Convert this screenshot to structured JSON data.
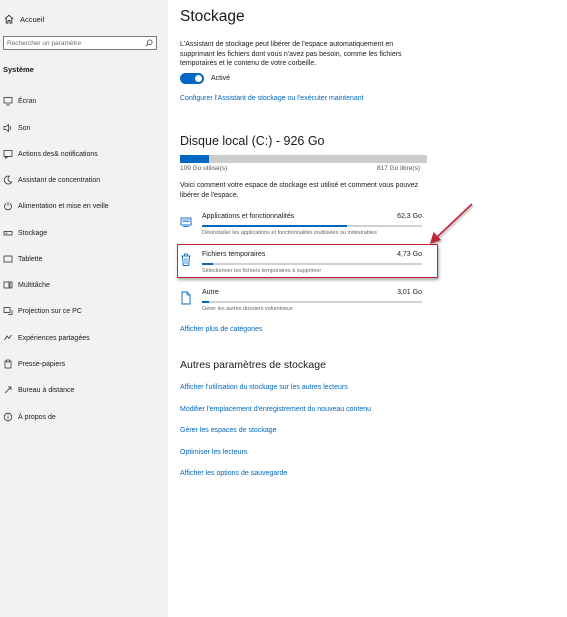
{
  "sidebar": {
    "home_label": "Accueil",
    "search_placeholder": "Rechercher un paramètre",
    "section_title": "Système",
    "items": [
      {
        "label": "Écran",
        "icon": "monitor-icon"
      },
      {
        "label": "Son",
        "icon": "speaker-icon"
      },
      {
        "label": "Actions des& notifications",
        "icon": "notification-icon"
      },
      {
        "label": "Assistant de concentration",
        "icon": "moon-icon"
      },
      {
        "label": "Alimentation et mise en veille",
        "icon": "power-icon"
      },
      {
        "label": "Stockage",
        "icon": "storage-icon"
      },
      {
        "label": "Tablette",
        "icon": "tablet-icon"
      },
      {
        "label": "Multitâche",
        "icon": "multitask-icon"
      },
      {
        "label": "Projection sur ce PC",
        "icon": "projection-icon"
      },
      {
        "label": "Expériences partagées",
        "icon": "shared-icon"
      },
      {
        "label": "Presse-papiers",
        "icon": "clipboard-icon"
      },
      {
        "label": "Bureau à distance",
        "icon": "remote-desktop-icon"
      },
      {
        "label": "À propos de",
        "icon": "info-icon"
      }
    ]
  },
  "main": {
    "title": "Stockage",
    "description": "L'Assistant de stockage peut libérer de l'espace automatiquement en supprimant les fichiers dont vous n'avez pas besoin, comme les fichiers temporaires et le contenu de votre corbeille.",
    "toggle_state": "Activé",
    "configure_link": "Configurer l'Assistant de stockage ou l'exécuter maintenant",
    "disk": {
      "title": "Disque local (C:) - 926 Go",
      "used": "109 Go utilisé(s)",
      "free": "817 Go libre(s)",
      "used_fraction": 0.118,
      "description": "Voici comment votre espace de stockage est utilisé et comment vous pouvez libérer de l'espace."
    },
    "categories": [
      {
        "name": "Applications et fonctionnalités",
        "size": "62,3 Go",
        "sub": "Désinstaller les applications et fonctionnalités inutilisées ou indésirables",
        "fraction": 0.66,
        "icon": "apps-icon"
      },
      {
        "name": "Fichiers temporaires",
        "size": "4,73 Go",
        "sub": "Sélectionner les fichiers temporaires à supprimer",
        "fraction": 0.05,
        "icon": "trash-icon"
      },
      {
        "name": "Autre",
        "size": "3,01 Go",
        "sub": "Gérer les autres dossiers volumineux",
        "fraction": 0.03,
        "icon": "document-icon"
      }
    ],
    "more_categories_link": "Afficher plus de catégories",
    "other_settings_title": "Autres paramètres de stockage",
    "other_links": [
      "Afficher l'utilisation du stockage sur les autres lecteurs",
      "Modifier l'emplacement d'enregistrement du nouveau contenu",
      "Gérer les espaces de stockage",
      "Optimiser les lecteurs",
      "Afficher les options de sauvegarde"
    ]
  },
  "colors": {
    "accent": "#0067c0",
    "highlight_border": "#c0283a",
    "arrow": "#c0283a"
  }
}
